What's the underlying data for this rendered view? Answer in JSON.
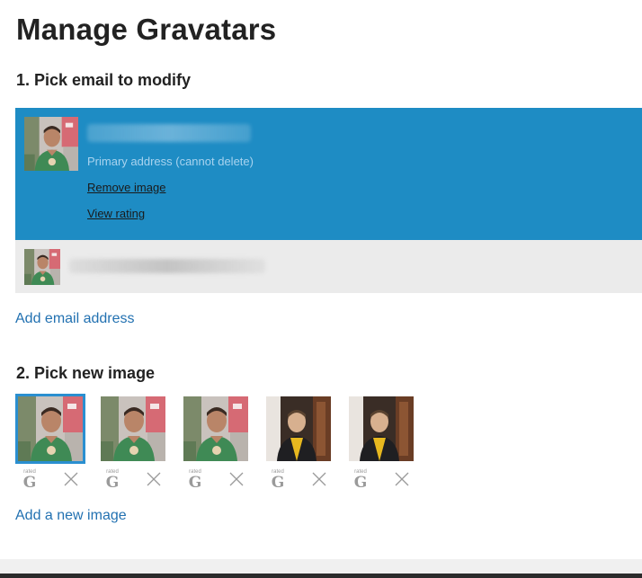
{
  "page": {
    "title": "Manage Gravatars"
  },
  "section1": {
    "title": "1. Pick email to modify",
    "selected_email": {
      "primary_note": "Primary address (cannot delete)",
      "remove_image": "Remove image",
      "view_rating": "View rating"
    },
    "add_email": "Add email address"
  },
  "section2": {
    "title": "2. Pick new image",
    "images": [
      {
        "rating_small": "rated",
        "rating_letter": "G",
        "selected": true
      },
      {
        "rating_small": "rated",
        "rating_letter": "G",
        "selected": false
      },
      {
        "rating_small": "rated",
        "rating_letter": "G",
        "selected": false
      },
      {
        "rating_small": "rated",
        "rating_letter": "G",
        "selected": false
      },
      {
        "rating_small": "rated",
        "rating_letter": "G",
        "selected": false
      }
    ],
    "add_image": "Add a new image"
  },
  "colors": {
    "selected_row": "#1e8cc4",
    "link": "#2271b1",
    "unselected_row": "#ebebeb"
  }
}
